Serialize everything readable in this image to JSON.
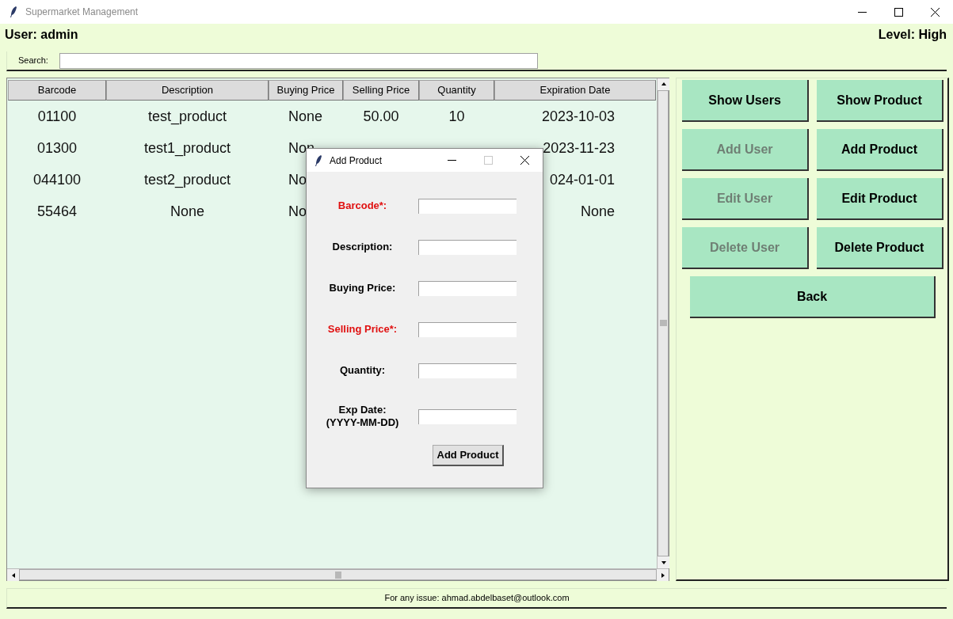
{
  "window": {
    "title": "Supermarket Management"
  },
  "header": {
    "user": "User: admin",
    "level": "Level: High"
  },
  "search": {
    "label": "Search:"
  },
  "table": {
    "columns": [
      "Barcode",
      "Description",
      "Buying Price",
      "Selling Price",
      "Quantity",
      "Expiration Date"
    ],
    "rows": [
      {
        "barcode": "01100",
        "description": "test_product",
        "buying_price": "None",
        "selling_price": "50.00",
        "quantity": "10",
        "expiration_date": "2023-10-03"
      },
      {
        "barcode": "01300",
        "description": "test1_product",
        "buying_price": "Non",
        "expiration_date": "2023-11-23"
      },
      {
        "barcode": "044100",
        "description": "test2_product",
        "buying_price": "No",
        "expiration_date": "024-01-01"
      },
      {
        "barcode": "55464",
        "description": "None",
        "buying_price": "No",
        "expiration_date": "None"
      }
    ]
  },
  "actions": [
    {
      "label": "Show Users",
      "disabled": false
    },
    {
      "label": "Show Product",
      "disabled": false
    },
    {
      "label": "Add User",
      "disabled": true
    },
    {
      "label": "Add Product",
      "disabled": false
    },
    {
      "label": "Edit User",
      "disabled": true
    },
    {
      "label": "Edit Product",
      "disabled": false
    },
    {
      "label": "Delete User",
      "disabled": true
    },
    {
      "label": "Delete Product",
      "disabled": false
    }
  ],
  "back": {
    "label": "Back"
  },
  "status_bar": "For any issue: ahmad.abdelbaset@outlook.com",
  "dialog": {
    "title": "Add Product",
    "fields": [
      {
        "label": "Barcode*:",
        "required": true
      },
      {
        "label": "Description:",
        "required": false
      },
      {
        "label": "Buying Price:",
        "required": false
      },
      {
        "label": "Selling Price*:",
        "required": true
      },
      {
        "label": "Quantity:",
        "required": false
      },
      {
        "label": "Exp Date:\n(YYYY-MM-DD)",
        "required": false
      }
    ],
    "submit": "Add Product"
  }
}
